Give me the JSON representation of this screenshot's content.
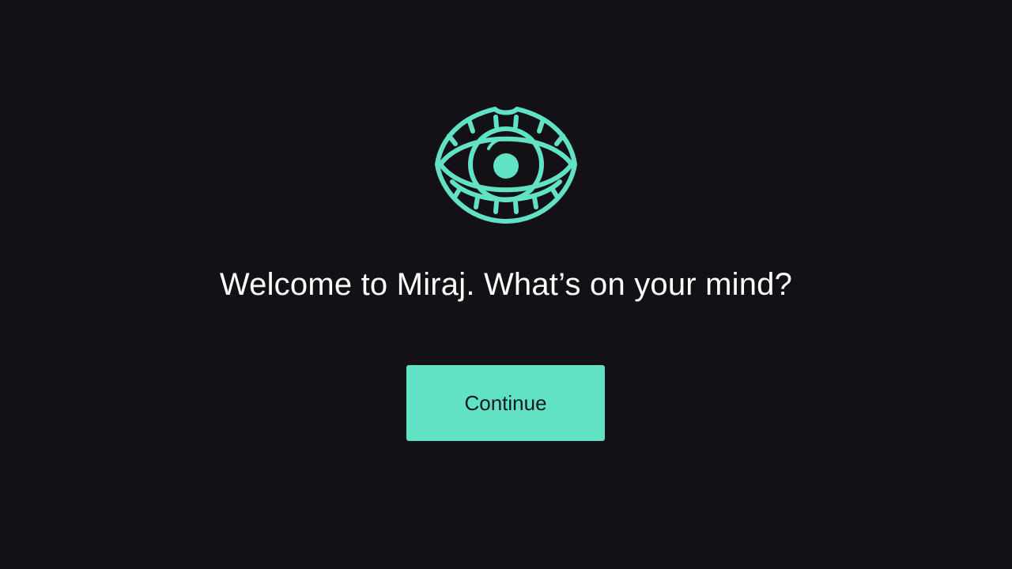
{
  "welcome": {
    "heading": "Welcome to Miraj. What’s on your mind?",
    "continue_label": "Continue"
  },
  "logo": {
    "icon": "eye-lips-icon",
    "color": "#62e2c4"
  },
  "colors": {
    "background": "#141116",
    "accent": "#62e2c4",
    "text": "#ffffff",
    "button_text": "#16181a"
  }
}
